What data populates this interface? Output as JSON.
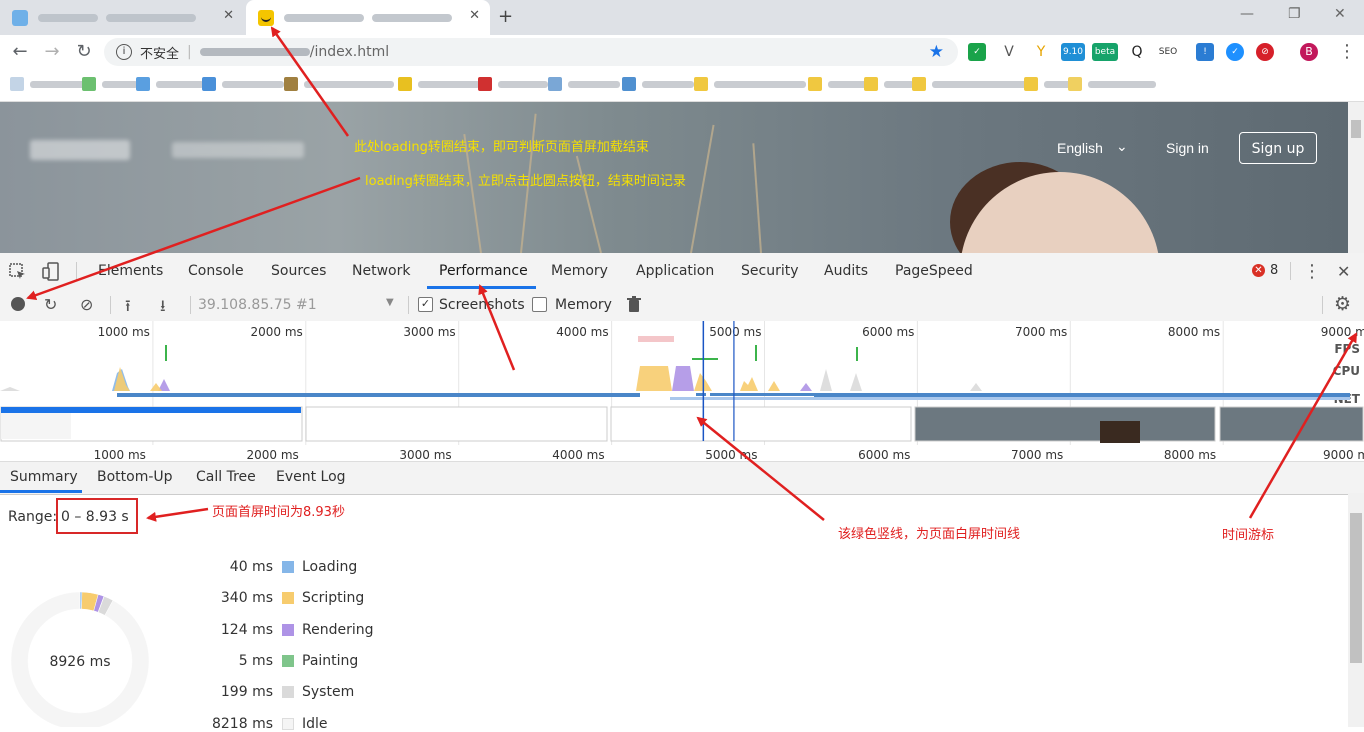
{
  "browser": {
    "tabs": [
      {
        "state": "inactive"
      },
      {
        "state": "active"
      }
    ],
    "new_tab": "+",
    "window_controls": {
      "minimize": "—",
      "restore": "❐",
      "close": "✕"
    },
    "address": {
      "security_label": "不安全",
      "url_suffix": "/index.html"
    },
    "extensions": {
      "badge_version": "9.10",
      "badge_beta": "beta",
      "seo": "SEO",
      "profile": "B"
    }
  },
  "website": {
    "nav": {
      "language": "English",
      "language_caret": "⌄",
      "sign_in": "Sign in",
      "sign_up": "Sign up"
    }
  },
  "devtools": {
    "panel_tabs": [
      "Elements",
      "Console",
      "Sources",
      "Network",
      "Performance",
      "Memory",
      "Application",
      "Security",
      "Audits",
      "PageSpeed"
    ],
    "active_tab": "Performance",
    "error_count": "8",
    "controls": {
      "recording_target": "39.108.85.75 #1",
      "screenshots_label": "Screenshots",
      "screenshots_checked": true,
      "memory_label": "Memory",
      "memory_checked": false
    },
    "timeline": {
      "ticks": [
        "1000 ms",
        "2000 ms",
        "3000 ms",
        "4000 ms",
        "5000 ms",
        "6000 ms",
        "7000 ms",
        "8000 ms",
        "9000 ms"
      ],
      "tick_values_ms": [
        1000,
        2000,
        3000,
        4000,
        5000,
        6000,
        7000,
        8000,
        9000
      ],
      "lower_ticks": [
        "1000 ms",
        "2000 ms",
        "3000 ms",
        "4000 ms",
        "5000 ms",
        "6000 ms",
        "7000 ms",
        "8000 ms",
        "9000 m"
      ],
      "track_labels": [
        "FPS",
        "CPU",
        "NET"
      ],
      "range_ms": [
        0,
        9000
      ]
    },
    "bottom_tabs": [
      "Summary",
      "Bottom-Up",
      "Call Tree",
      "Event Log"
    ],
    "active_bottom_tab": "Summary",
    "summary": {
      "range_label": "Range:",
      "range_value": "0 – 8.93 s",
      "total": "8926 ms",
      "rows": [
        {
          "value": "40 ms",
          "label": "Loading",
          "color": "#85b6e8",
          "ms": 40
        },
        {
          "value": "340 ms",
          "label": "Scripting",
          "color": "#f7cc6e",
          "ms": 340
        },
        {
          "value": "124 ms",
          "label": "Rendering",
          "color": "#ae93e6",
          "ms": 124
        },
        {
          "value": "5 ms",
          "label": "Painting",
          "color": "#7fc58b",
          "ms": 5
        },
        {
          "value": "199 ms",
          "label": "System",
          "color": "#dadada",
          "ms": 199
        },
        {
          "value": "8218 ms",
          "label": "Idle",
          "color": "#f5f5f5",
          "ms": 8218
        }
      ]
    }
  },
  "annotations": {
    "note1": "此处loading转圈结束，即可判断页面首屏加载结束",
    "note2": "loading转圈结束，立即点击此圆点按钮，结束时间记录",
    "note3": "页面首屏时间为8.93秒",
    "note4": "该绿色竖线，为页面白屏时间线",
    "note5": "时间游标"
  }
}
